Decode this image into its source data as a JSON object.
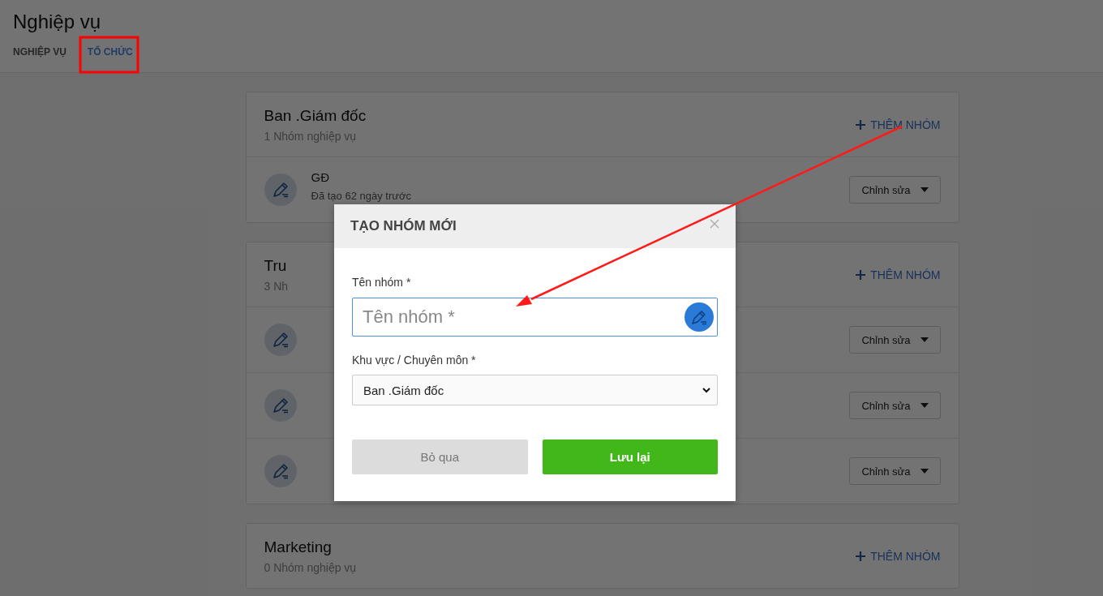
{
  "page": {
    "title": "Nghiệp vụ"
  },
  "tabs": [
    {
      "label": "NGHIỆP VỤ",
      "selected": false
    },
    {
      "label": "TỔ CHỨC",
      "selected": true
    }
  ],
  "departments": [
    {
      "name": "Ban .Giám đốc",
      "count": "1 Nhóm nghiệp vụ",
      "add_label": "THÊM NHÓM",
      "groups": [
        {
          "name": "GĐ",
          "created": "Đã tạo 62 ngày trước",
          "menu_label": "Chỉnh sửa"
        }
      ]
    },
    {
      "name": "Tru",
      "count": "3 Nh",
      "add_label": "THÊM NHÓM",
      "groups": [
        {
          "menu_label": "Chỉnh sửa"
        },
        {
          "menu_label": "Chỉnh sửa"
        },
        {
          "menu_label": "Chỉnh sửa"
        }
      ]
    },
    {
      "name": "Marketing",
      "count": "0 Nhóm nghiệp vụ",
      "add_label": "THÊM NHÓM"
    }
  ],
  "dialog": {
    "title": "TẠO NHÓM MỚI",
    "name_label": "Tên nhóm *",
    "name_placeholder": "Tên nhóm *",
    "area_label": "Khu vực / Chuyên môn *",
    "area_value": "Ban .Giám đốc",
    "cancel_label": "Bỏ qua",
    "save_label": "Lưu lại"
  }
}
